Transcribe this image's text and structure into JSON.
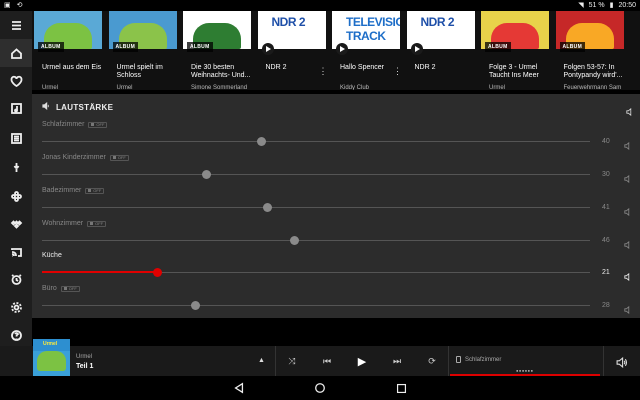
{
  "status_bar": {
    "left_icons": [
      "gallery-icon",
      "sync-icon"
    ],
    "battery": "51 %",
    "time": "20:50"
  },
  "rail": [
    {
      "icon": "menu-icon",
      "label": "Menu"
    },
    {
      "icon": "home-icon",
      "label": "Home"
    },
    {
      "icon": "heart-icon",
      "label": "Favorites"
    },
    {
      "icon": "music-library-icon",
      "label": "Library"
    },
    {
      "icon": "list-icon",
      "label": "Playlists"
    },
    {
      "icon": "microphone-icon",
      "label": "Podcasts"
    },
    {
      "icon": "flower-service-icon",
      "label": "Service"
    },
    {
      "icon": "tidal-icon",
      "label": "Tidal"
    },
    {
      "icon": "cast-icon",
      "label": "Cast"
    },
    {
      "icon": "alarm-icon",
      "label": "Alarm"
    },
    {
      "icon": "settings-icon",
      "label": "Settings"
    },
    {
      "icon": "help-icon",
      "label": "Help"
    },
    {
      "icon": "feedback-icon",
      "label": "Feedback"
    }
  ],
  "carousel": [
    {
      "type": "ALBUM",
      "title": "Urmel aus dem Eis",
      "subtitle": "Urmel",
      "art": "#5aa9d6",
      "art2": "#7cc243",
      "play": false,
      "more": false
    },
    {
      "type": "ALBUM",
      "title": "Urmel spielt im Schloss",
      "subtitle": "Urmel",
      "art": "#4a9ad0",
      "art2": "#8bc34a",
      "play": false,
      "more": false
    },
    {
      "type": "ALBUM",
      "title": "Die 30 besten Weihnachts- Und...",
      "subtitle": "Simone Sommerland",
      "art": "#ffffff",
      "art2": "#2e7d32",
      "play": false,
      "more": false
    },
    {
      "type": "RADIO",
      "title": "NDR 2",
      "subtitle": "",
      "art": "#ffffff",
      "art2": "#1e4fa8",
      "play": true,
      "more": true,
      "logo": "NDR 2"
    },
    {
      "type": "TITEL",
      "title": "Hallo Spencer",
      "subtitle": "Kiddy Club",
      "art": "#ffffff",
      "art2": "#1e6ec8",
      "play": true,
      "more": true,
      "logo": "TELEVISION TRACK"
    },
    {
      "type": "RADIO",
      "title": "NDR 2",
      "subtitle": "",
      "art": "#ffffff",
      "art2": "#1e4fa8",
      "play": true,
      "more": false,
      "logo": "NDR 2"
    },
    {
      "type": "ALBUM",
      "title": "Folge 3 - Urmel Taucht Ins Meer",
      "subtitle": "Urmel",
      "art": "#e8d24a",
      "art2": "#e53935",
      "play": false,
      "more": false
    },
    {
      "type": "ALBUM",
      "title": "Folgen 53-57: In Pontypandy wird'...",
      "subtitle": "Feuerwehrmann Sam",
      "art": "#c62828",
      "art2": "#f9a825",
      "play": false,
      "more": false
    }
  ],
  "volume": {
    "heading": "LAUTSTÄRKE",
    "accent": "#e00000",
    "rooms": [
      {
        "name": "Schlafzimmer",
        "toggle": "OFF",
        "value": 40,
        "active": false
      },
      {
        "name": "Jonas Kinderzimmer",
        "toggle": "OFF",
        "value": 30,
        "active": false
      },
      {
        "name": "Badezimmer",
        "toggle": "OFF",
        "value": 41,
        "active": false
      },
      {
        "name": "Wohnzimmer",
        "toggle": "OFF",
        "value": 46,
        "active": false
      },
      {
        "name": "Küche",
        "toggle": "",
        "value": 21,
        "active": true
      },
      {
        "name": "Büro",
        "toggle": "OFF",
        "value": 28,
        "active": false
      }
    ]
  },
  "now_playing": {
    "artist": "Urmel",
    "title": "Teil 1",
    "art_label": "Urmel",
    "room": "Schlafzimmer",
    "dots": "●●●●●●"
  }
}
